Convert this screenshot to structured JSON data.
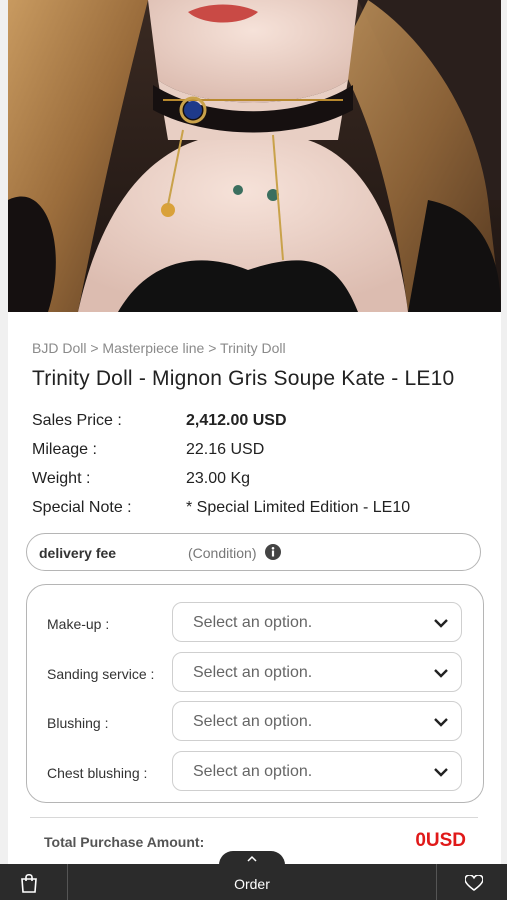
{
  "product": {
    "image_alt": "Trinity Doll product photo",
    "breadcrumb": "BJD Doll > Masterpiece line > Trinity Doll",
    "title": "Trinity Doll - Mignon Gris Soupe Kate - LE10",
    "info": [
      {
        "label": "Sales Price :",
        "value": "2,412.00 USD",
        "bold": true
      },
      {
        "label": "Mileage :",
        "value": "22.16 USD"
      },
      {
        "label": "Weight :",
        "value": "23.00 Kg"
      },
      {
        "label": "Special Note :",
        "value": "* Special Limited Edition - LE10"
      }
    ]
  },
  "delivery": {
    "label": "delivery fee",
    "condition": "(Condition)",
    "icon": "info-icon"
  },
  "options": [
    {
      "label": "Make-up :",
      "placeholder": "Select an option."
    },
    {
      "label": "Sanding service :",
      "placeholder": "Select an option."
    },
    {
      "label": "Blushing :",
      "placeholder": "Select an option."
    },
    {
      "label": "Chest blushing :",
      "placeholder": "Select an option."
    }
  ],
  "total": {
    "label": "Total Purchase Amount:",
    "value": "0USD",
    "color": "#e01919"
  },
  "bottom_bar": {
    "cart_icon": "cart-icon",
    "order_label": "Order",
    "heart_icon": "heart-icon",
    "expand_icon": "chevron-up-icon",
    "background": "#2b2b2b"
  }
}
